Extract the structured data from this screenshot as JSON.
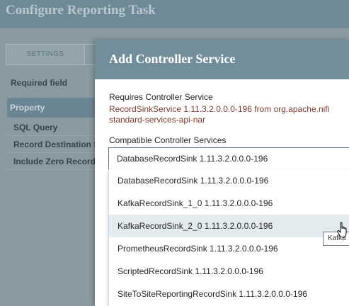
{
  "background": {
    "title": "Configure Reporting Task",
    "tab_settings": "SETTINGS",
    "required_field": "Required field",
    "table_header": "Property",
    "rows": [
      "SQL Query",
      "Record Destination Se",
      "Include Zero Record R"
    ]
  },
  "modal": {
    "title": "Add Controller Service",
    "requires_label": "Requires Controller Service",
    "requires_line1": "RecordSinkService 1.11.3.2.0.0.0-196 from org.apache.nifi",
    "requires_line2": "standard-services-api-nar",
    "compatible_label": "Compatible Controller Services",
    "selected_value": "DatabaseRecordSink 1.11.3.2.0.0.0-196",
    "options": [
      "DatabaseRecordSink 1.11.3.2.0.0.0-196",
      "KafkaRecordSink_1_0 1.11.3.2.0.0.0-196",
      "KafkaRecordSink_2_0 1.11.3.2.0.0.0-196",
      "PrometheusRecordSink 1.11.3.2.0.0.0-196",
      "ScriptedRecordSink 1.11.3.2.0.0.0-196",
      "SiteToSiteReportingRecordSink 1.11.3.2.0.0.0-196"
    ],
    "hovered_index": 2
  },
  "tooltip": "Kafka"
}
